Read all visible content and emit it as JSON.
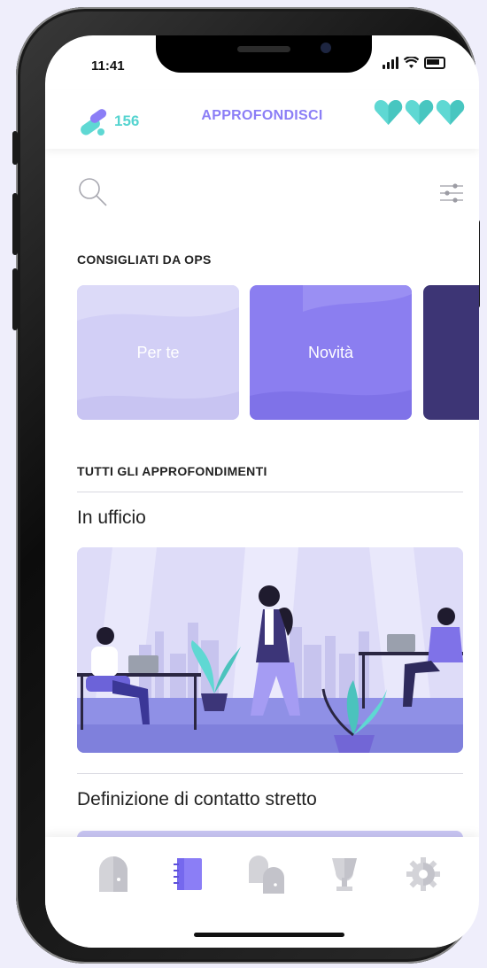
{
  "status_bar": {
    "time": "11:41"
  },
  "header": {
    "points": "156",
    "title": "APPROFONDISCI",
    "lives": 3
  },
  "search": {
    "icon": "search-icon",
    "filter_icon": "filter-icon"
  },
  "recommended": {
    "title": "CONSIGLIATI DA OPS",
    "cards": [
      {
        "label": "Per te",
        "color": "#d2cff6"
      },
      {
        "label": "Novità",
        "color": "#8b7ef0"
      },
      {
        "label": "",
        "color": "#3d3575"
      }
    ]
  },
  "all": {
    "title": "TUTTI GLI APPROFONDIMENTI",
    "items": [
      {
        "title": "In ufficio"
      },
      {
        "title": "Definizione di contatto stretto"
      }
    ]
  },
  "tabbar": {
    "tabs": [
      {
        "name": "tab-home",
        "icon": "door-icon",
        "active": false
      },
      {
        "name": "tab-approfondisci",
        "icon": "book-icon",
        "active": true
      },
      {
        "name": "tab-community",
        "icon": "doors-icon",
        "active": false
      },
      {
        "name": "tab-trophies",
        "icon": "trophy-icon",
        "active": false
      },
      {
        "name": "tab-settings",
        "icon": "gear-icon",
        "active": false
      }
    ]
  },
  "colors": {
    "accent": "#8b7ef6",
    "teal": "#56d4d0"
  }
}
